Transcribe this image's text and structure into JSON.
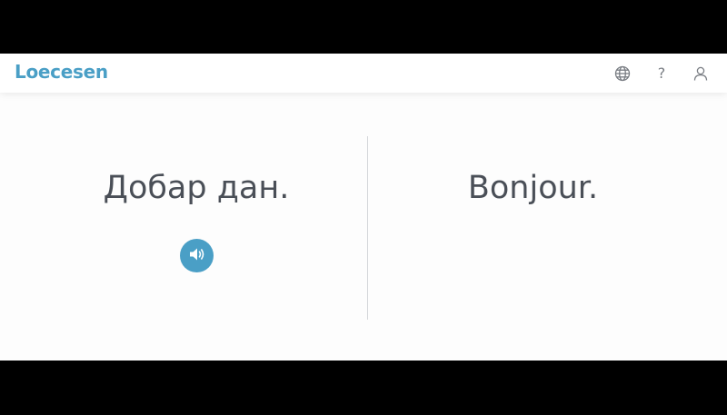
{
  "app": {
    "logo_text": "Loecesen",
    "brand_color": "#4a9fc6"
  },
  "header": {
    "icons": [
      "globe-icon",
      "help-icon",
      "user-icon"
    ],
    "help_glyph": "?"
  },
  "card": {
    "source_phrase": "Добар дан.",
    "target_phrase": "Bonjour.",
    "audio_icon": "speaker-icon"
  }
}
